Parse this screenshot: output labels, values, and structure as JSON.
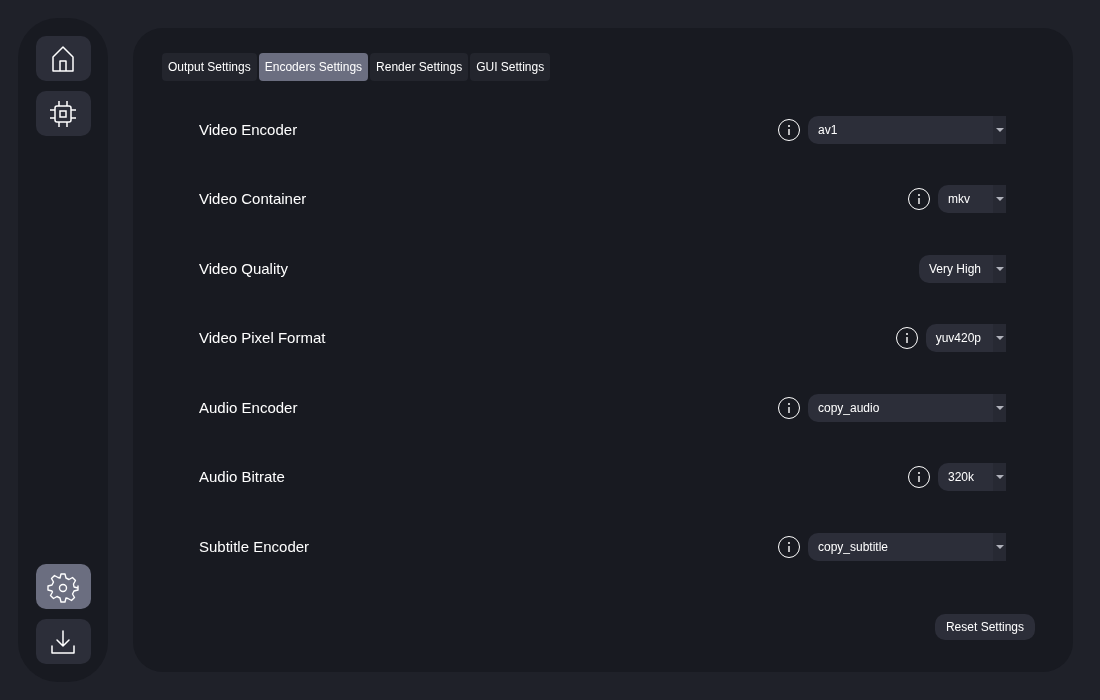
{
  "sidebar": {
    "top_items": [
      {
        "selected": false
      },
      {
        "selected": false
      }
    ],
    "bottom_items": [
      {
        "selected": true
      },
      {
        "selected": false
      }
    ]
  },
  "tabs": [
    {
      "label": "Output Settings",
      "selected": false
    },
    {
      "label": "Encoders Settings",
      "selected": true
    },
    {
      "label": "Render Settings",
      "selected": false
    },
    {
      "label": "GUI Settings",
      "selected": false
    }
  ],
  "settings": [
    {
      "label": "Video Encoder",
      "info": true,
      "value": "av1",
      "kind": "wide"
    },
    {
      "label": "Video Container",
      "info": true,
      "value": "mkv",
      "kind": "fit"
    },
    {
      "label": "Video Quality",
      "info": false,
      "value": "Very High",
      "kind": "fit"
    },
    {
      "label": "Video Pixel Format",
      "info": true,
      "value": "yuv420p",
      "kind": "fit"
    },
    {
      "label": "Audio Encoder",
      "info": true,
      "value": "copy_audio",
      "kind": "wide"
    },
    {
      "label": "Audio Bitrate",
      "info": true,
      "value": "320k",
      "kind": "fit"
    },
    {
      "label": "Subtitle Encoder",
      "info": true,
      "value": "copy_subtitle",
      "kind": "wide"
    }
  ],
  "reset_button": "Reset Settings"
}
